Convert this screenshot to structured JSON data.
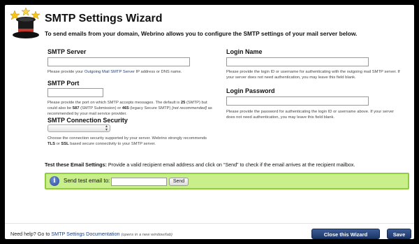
{
  "header": {
    "title": "SMTP Settings Wizard",
    "intro": "To send emails from your domain, Webrino allows you to configure the SMTP settings of your mail server below."
  },
  "left": {
    "smtp_server": {
      "label": "SMTP Server",
      "value": "",
      "help_prefix": "Please provide your ",
      "help_link": "Outgoing Mail SMTP Server",
      "help_suffix": " IP address or DNS name."
    },
    "smtp_port": {
      "label": "SMTP Port",
      "value": "",
      "help_1": "Please provide the port on which SMTP accepts messages. The default is ",
      "help_default": "25",
      "help_2": " (SMTP) but could also be ",
      "help_587": "587",
      "help_3": " (SMTP Submission) or ",
      "help_465": "465",
      "help_4": " (legacy Secure SMTP) ",
      "help_not_rec": "[not recommended]",
      "help_5": " as recommended by your mail service provider."
    },
    "security": {
      "label": "SMTP Connection Security",
      "selected": "",
      "help_1": "Choose the connection security supported by your server. Webrino strongly recommends ",
      "help_tls": "TLS",
      "help_or": " or ",
      "help_ssl": "SSL",
      "help_2": " based secure connectivity to your SMTP server."
    }
  },
  "right": {
    "login_name": {
      "label": "Login Name",
      "value": "",
      "help": "Please provide the login ID or username for authenticating with the outgoing mail SMTP server. If your server does not need authentication, you may leave this field blank."
    },
    "login_password": {
      "label": "Login Password",
      "value": "",
      "help": "Please provide the password for authenticating the login ID or username above. If your server does not need authentication, you may leave this field blank."
    }
  },
  "test": {
    "heading": "Test these Email Settings:",
    "instructions": " Provide a valid recipient email address and click on “Send” to check if the email arrives at the recipient mailbox.",
    "send_label": "Send test email to:",
    "email_value": "",
    "send_button": "Send"
  },
  "footer": {
    "need_help": "Need help? Go to ",
    "doc_link": "SMTP Settings Documentation",
    "new_window": "(opens in a new window/tab)",
    "close_button": "Close this Wizard",
    "save_button": "Save"
  },
  "colors": {
    "accent": "#1d3567",
    "link": "#1c3e7a",
    "test_box_bg": "#c9ef8a",
    "test_box_border": "#8fcc3e"
  },
  "icons": {
    "logo": "magic-hat-icon",
    "info": "info-icon",
    "dropdown": "chevron-updown-icon"
  }
}
